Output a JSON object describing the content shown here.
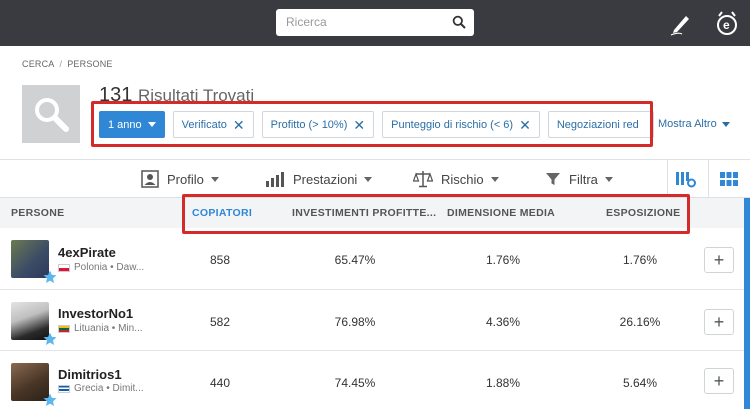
{
  "topbar": {
    "search_placeholder": "Ricerca",
    "icons": [
      "search-icon",
      "pencil-icon",
      "etoro-logo-icon"
    ]
  },
  "breadcrumb": {
    "items": [
      "CERCA",
      "PERSONE"
    ]
  },
  "results": {
    "count": "131",
    "label": "Risultati Trovati"
  },
  "filters": {
    "period": "1 anno",
    "chips": [
      "Verificato",
      "Profitto (> 10%)",
      "Punteggio di rischio (< 6)",
      "Negoziazioni red"
    ],
    "more_label": "Mostra Altro"
  },
  "toolbar": {
    "profile": "Profilo",
    "performance": "Prestazioni",
    "risk": "Rischio",
    "filter": "Filtra"
  },
  "table": {
    "columns": [
      "PERSONE",
      "COPIATORI",
      "INVESTIMENTI PROFITTE...",
      "DIMENSIONE MEDIA",
      "ESPOSIZIONE"
    ],
    "rows": [
      {
        "name": "4exPirate",
        "country": "Polonia • Daw...",
        "copiers": "858",
        "profitable": "65.47%",
        "avg_size": "1.76%",
        "exposure": "1.76%"
      },
      {
        "name": "InvestorNo1",
        "country": "Lituania • Min...",
        "copiers": "582",
        "profitable": "76.98%",
        "avg_size": "4.36%",
        "exposure": "26.16%"
      },
      {
        "name": "Dimitrios1",
        "country": "Grecia • Dimit...",
        "copiers": "440",
        "profitable": "74.45%",
        "avg_size": "1.88%",
        "exposure": "5.64%"
      }
    ]
  },
  "colors": {
    "accent": "#2f87d6",
    "highlight": "#d42a2a",
    "topbar": "#3a3b40"
  }
}
